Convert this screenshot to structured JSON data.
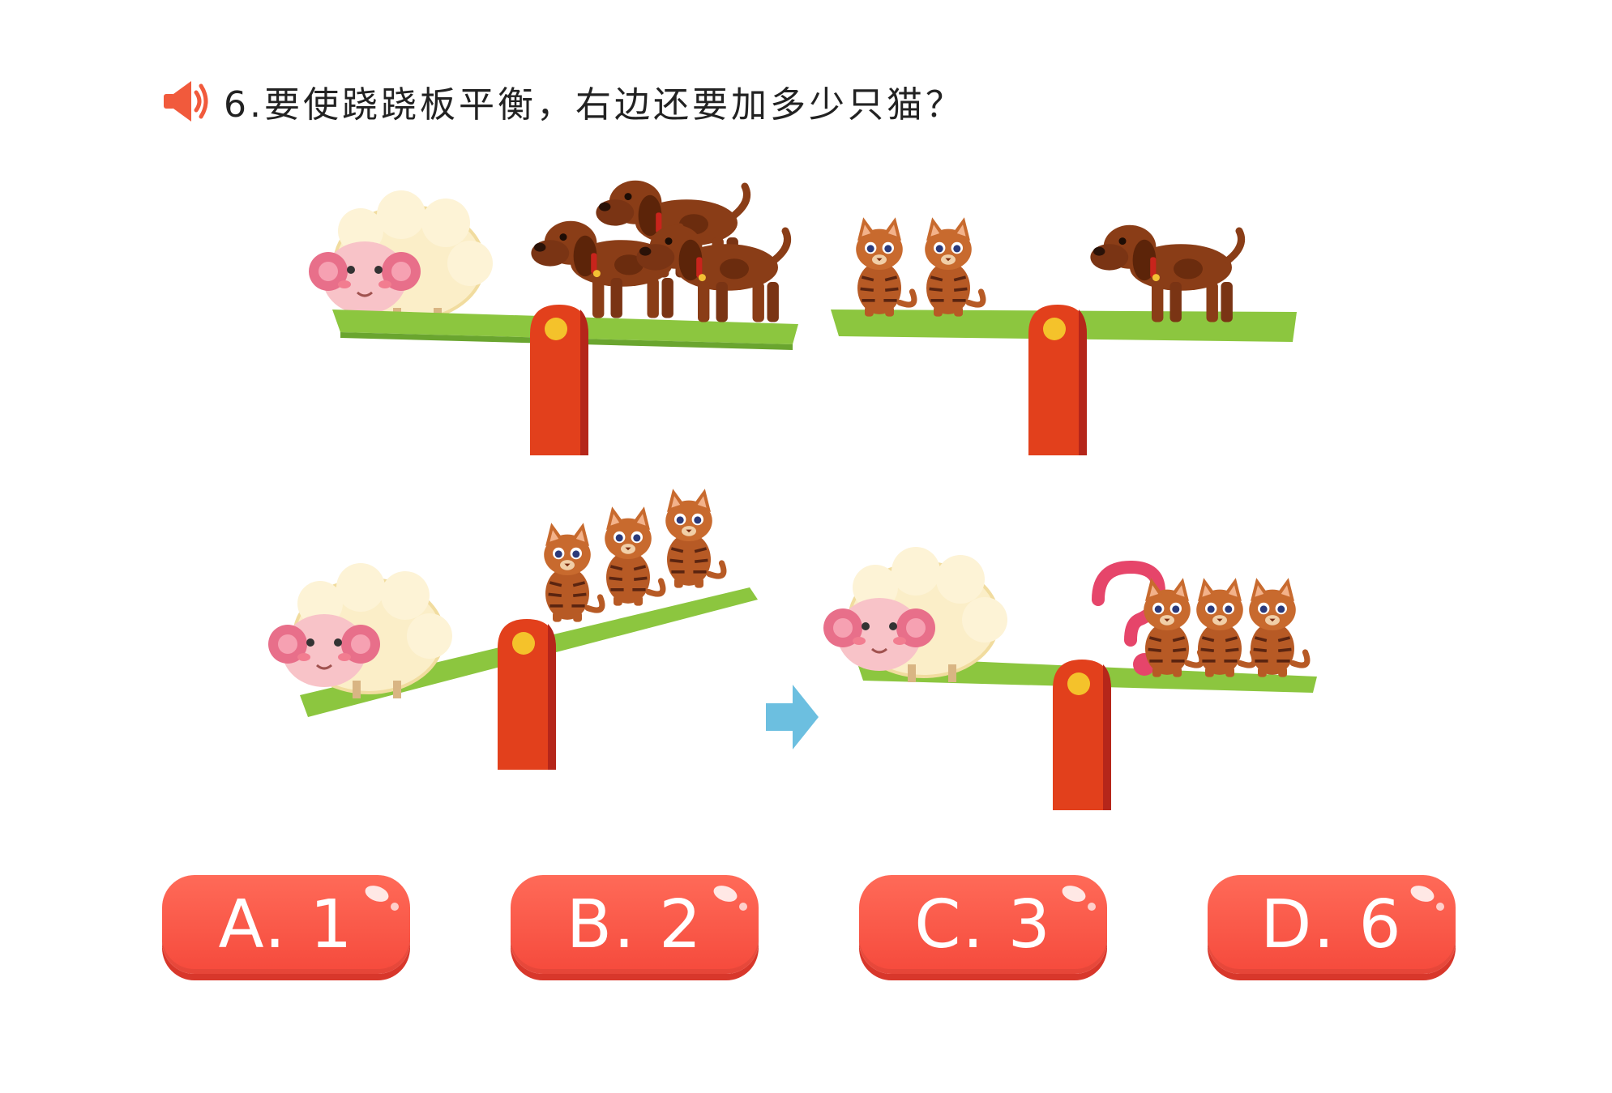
{
  "question": {
    "text": "6.要使跷跷板平衡，右边还要加多少只猫？",
    "speaker_icon": "speaker-icon"
  },
  "colors": {
    "board": "#8cc63f",
    "pivot": "#e2401c",
    "pivot_dot": "#f4c22b",
    "button": "#f54a3c",
    "arrow": "#6cbfe0",
    "question_mark": "#e6456a"
  },
  "options": [
    {
      "label": "A. 1"
    },
    {
      "label": "B. 2"
    },
    {
      "label": "C. 3"
    },
    {
      "label": "D. 6"
    }
  ]
}
